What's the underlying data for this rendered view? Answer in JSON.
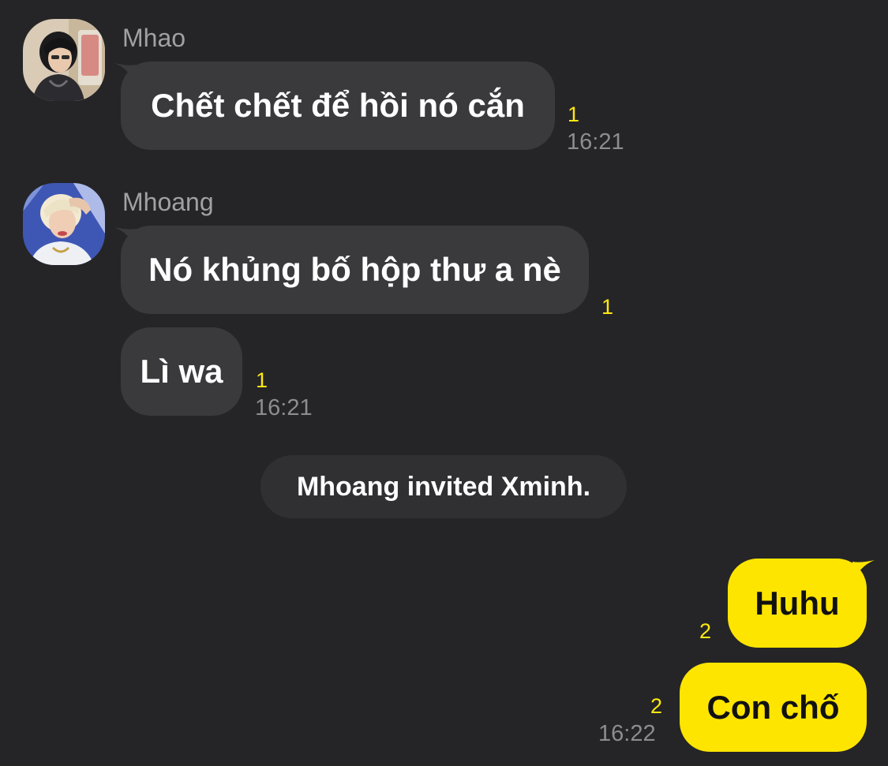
{
  "messages": [
    {
      "sender": "Mhao",
      "avatar_icon": "user-avatar-icon",
      "text": "Chết chết để hồi nó cắn",
      "unread": "1",
      "time": "16:21"
    },
    {
      "sender": "Mhoang",
      "avatar_icon": "user-avatar-icon",
      "text": "Nó khủng bố hộp thư a nè",
      "unread": "1"
    },
    {
      "text": "Lì wa",
      "unread": "1",
      "time": "16:21"
    }
  ],
  "system_notice": "Mhoang invited Xminh.",
  "my_messages": [
    {
      "text": "Huhu",
      "unread": "2"
    },
    {
      "text": "Con chố",
      "unread": "2",
      "time": "16:22"
    }
  ],
  "colors": {
    "background": "#252527",
    "incoming_bubble": "#3a3a3d",
    "outgoing_bubble": "#fee500",
    "unread_count": "#ffe812",
    "timestamp": "#8d8d90",
    "sender_name": "#a1a1a3"
  }
}
